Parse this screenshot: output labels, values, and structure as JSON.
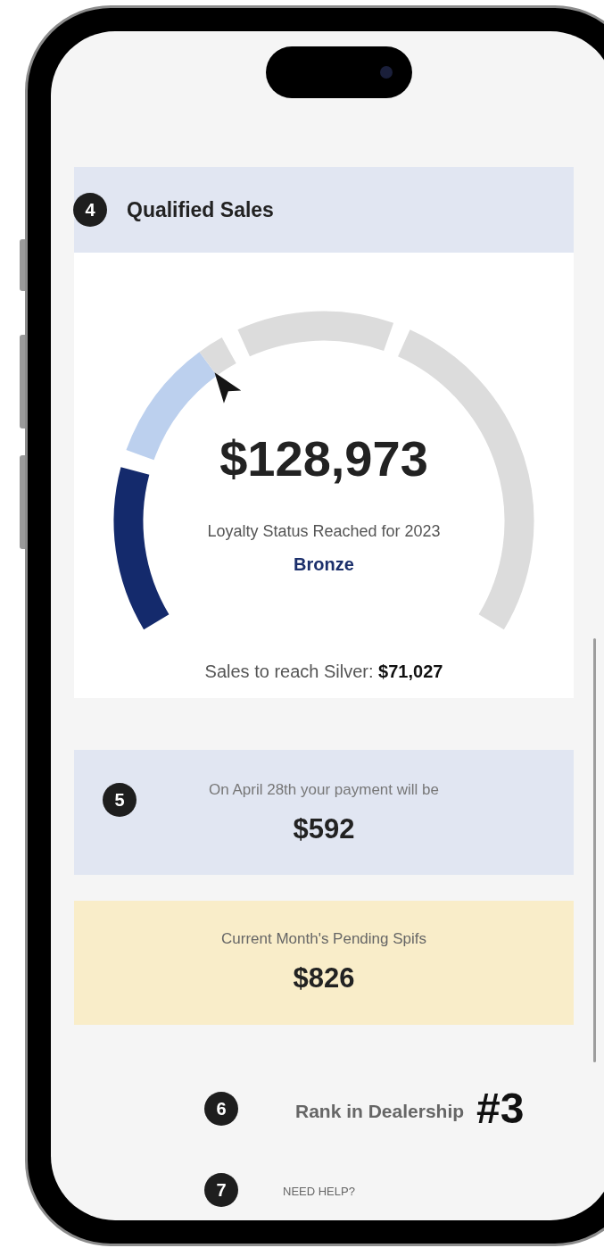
{
  "header": {
    "marker": "4",
    "title": "Qualified Sales"
  },
  "gauge": {
    "level": 0.35,
    "amount": "$128,973",
    "status_label": "Loyalty Status Reached for 2023",
    "status": "Bronze",
    "next": "Sales to reach Silver: **$71,027**"
  },
  "payment": {
    "marker": "5",
    "label": "On April 28th your payment will be",
    "amount": "$592"
  },
  "spifs": {
    "label": "Current Month's Pending Spifs",
    "amount": "$826"
  },
  "rank": {
    "marker": "6",
    "label": "Rank in Dealership",
    "value": "#3"
  },
  "help": {
    "marker": "7",
    "link": "NEED HELP?"
  }
}
